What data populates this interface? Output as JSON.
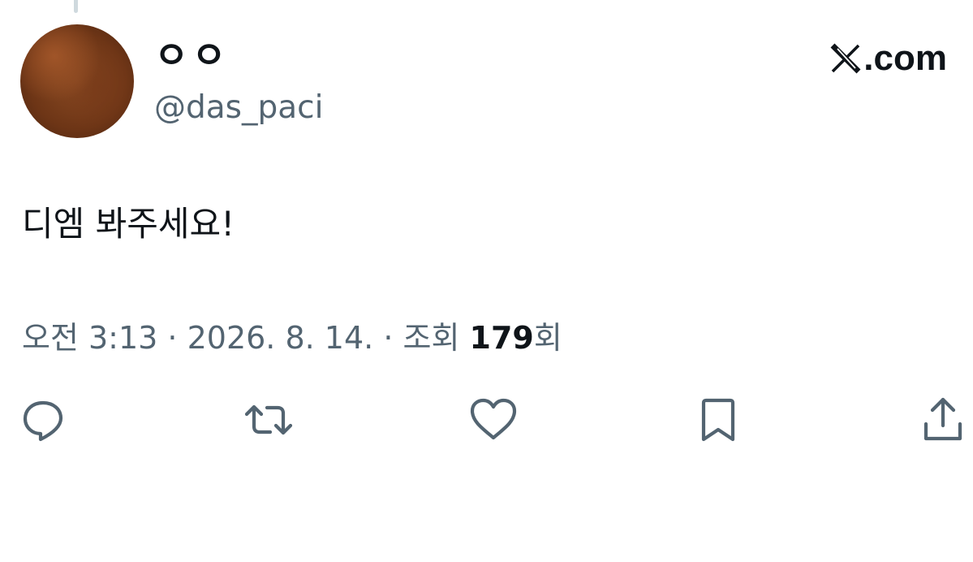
{
  "tweet": {
    "display_name": "ㅇㅇ",
    "handle": "@das_paci",
    "text": "디엠 봐주세요!",
    "time": "오전 3:13",
    "separator": " · ",
    "date": "2026. 8. 14.",
    "views_label": "조회",
    "views_count": "179",
    "views_suffix": "회"
  },
  "brand": {
    "domain": ".com",
    "logo_icon": "x-logo-icon"
  },
  "actions": [
    {
      "icon": "reply-icon"
    },
    {
      "icon": "retweet-icon"
    },
    {
      "icon": "like-icon"
    },
    {
      "icon": "bookmark-icon"
    },
    {
      "icon": "share-icon"
    }
  ],
  "colors": {
    "text_primary": "#0f1419",
    "text_secondary": "#536471",
    "icon": "#536471",
    "background": "#ffffff"
  }
}
